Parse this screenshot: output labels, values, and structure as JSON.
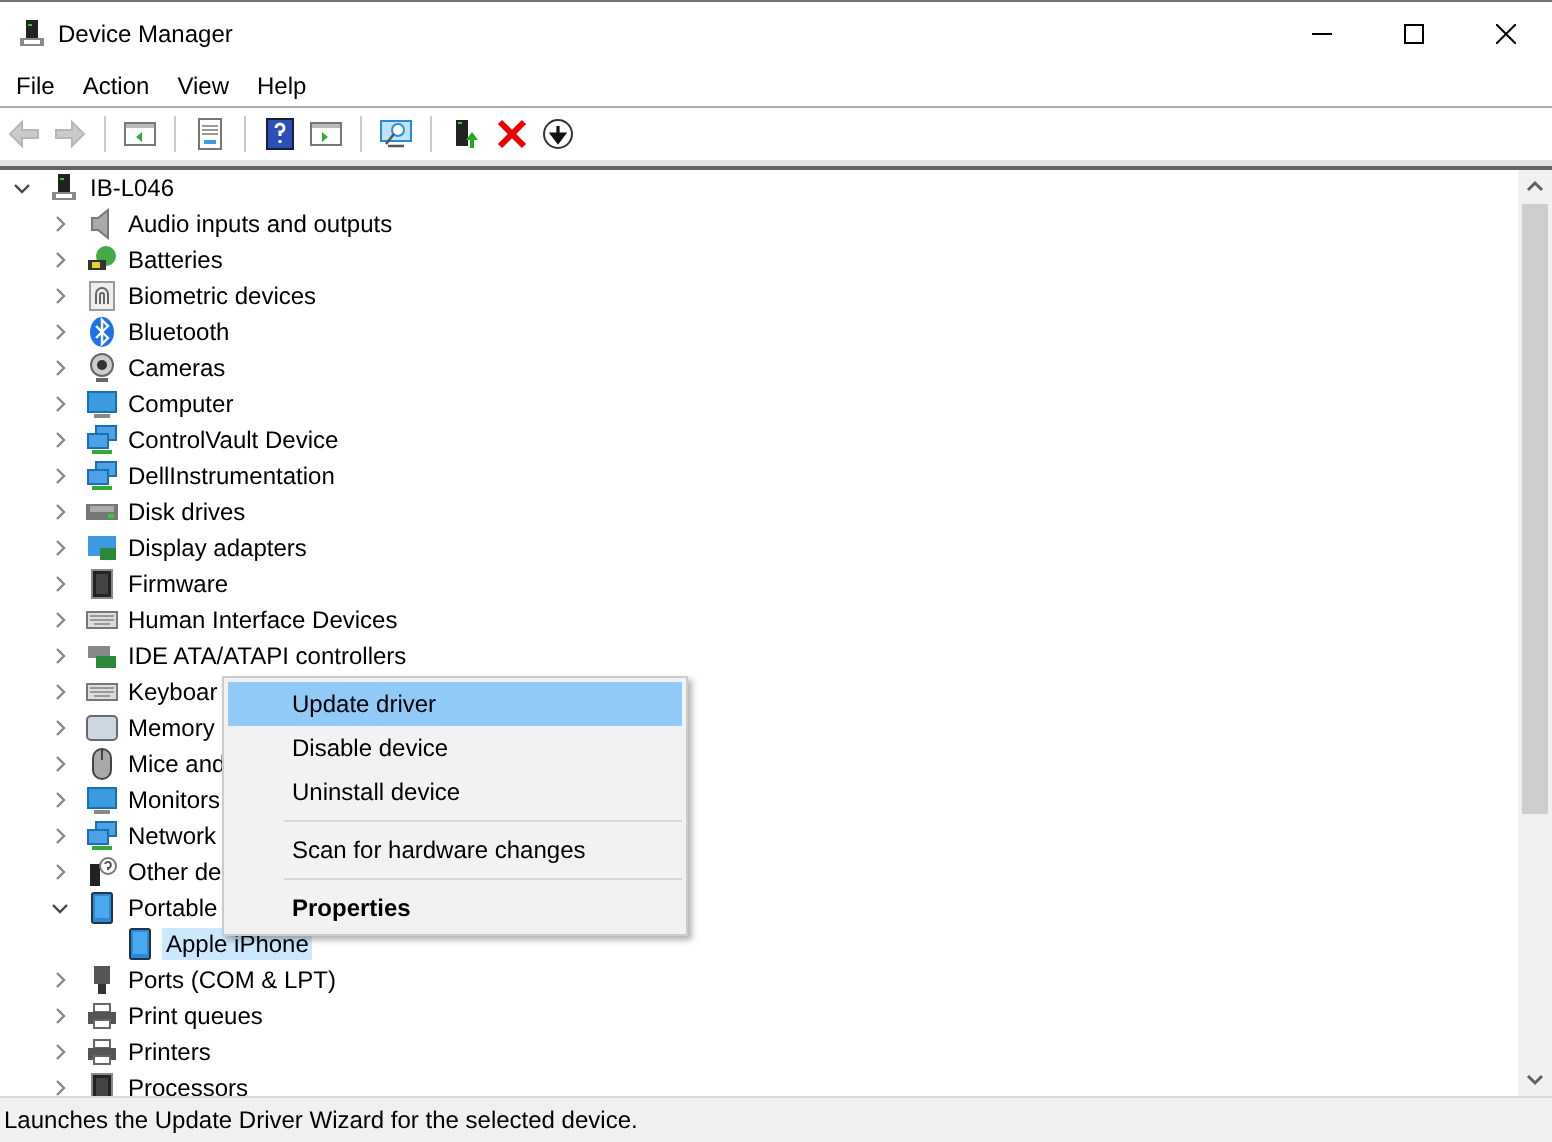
{
  "window": {
    "title": "Device Manager"
  },
  "menu_bar": [
    "File",
    "Action",
    "View",
    "Help"
  ],
  "toolbar": [
    {
      "disabled": true,
      "separator_before": false
    },
    {
      "disabled": true,
      "separator_before": false
    },
    {
      "disabled": false,
      "separator_before": true
    },
    {
      "disabled": false,
      "separator_before": true
    },
    {
      "disabled": false,
      "separator_before": true
    },
    {
      "disabled": false,
      "separator_before": false
    },
    {
      "disabled": false,
      "separator_before": true
    },
    {
      "disabled": false,
      "separator_before": true
    },
    {
      "disabled": false,
      "separator_before": false
    },
    {
      "disabled": false,
      "separator_before": false
    }
  ],
  "tree": {
    "label": "IB-L046",
    "expanded": true,
    "selected": false,
    "children": [
      {
        "label": "Audio inputs and outputs",
        "expanded": false,
        "selected": false
      },
      {
        "label": "Batteries",
        "expanded": false,
        "selected": false
      },
      {
        "label": "Biometric devices",
        "expanded": false,
        "selected": false
      },
      {
        "label": "Bluetooth",
        "expanded": false,
        "selected": false
      },
      {
        "label": "Cameras",
        "expanded": false,
        "selected": false
      },
      {
        "label": "Computer",
        "expanded": false,
        "selected": false
      },
      {
        "label": "ControlVault Device",
        "expanded": false,
        "selected": false
      },
      {
        "label": "DellInstrumentation",
        "expanded": false,
        "selected": false
      },
      {
        "label": "Disk drives",
        "expanded": false,
        "selected": false
      },
      {
        "label": "Display adapters",
        "expanded": false,
        "selected": false
      },
      {
        "label": "Firmware",
        "expanded": false,
        "selected": false
      },
      {
        "label": "Human Interface Devices",
        "expanded": false,
        "selected": false
      },
      {
        "label": "IDE ATA/ATAPI controllers",
        "expanded": false,
        "selected": false
      },
      {
        "label": "Keyboar",
        "expanded": false,
        "selected": false
      },
      {
        "label": "Memory",
        "expanded": false,
        "selected": false
      },
      {
        "label": "Mice and",
        "expanded": false,
        "selected": false
      },
      {
        "label": "Monitors",
        "expanded": false,
        "selected": false
      },
      {
        "label": "Network",
        "expanded": false,
        "selected": false
      },
      {
        "label": "Other de",
        "expanded": false,
        "selected": false
      },
      {
        "label": "Portable",
        "expanded": true,
        "selected": false,
        "children": [
          {
            "label": "Apple iPhone",
            "selected": true
          }
        ]
      },
      {
        "label": "Ports (COM & LPT)",
        "expanded": false,
        "selected": false
      },
      {
        "label": "Print queues",
        "expanded": false,
        "selected": false
      },
      {
        "label": "Printers",
        "expanded": false,
        "selected": false
      },
      {
        "label": "Processors",
        "expanded": false,
        "selected": false
      }
    ]
  },
  "context_menu": [
    {
      "label": "Update driver",
      "selected": true,
      "default": false,
      "separator_before": false
    },
    {
      "label": "Disable device",
      "selected": false,
      "default": false,
      "separator_before": false
    },
    {
      "label": "Uninstall device",
      "selected": false,
      "default": false,
      "separator_before": false
    },
    {
      "label": "Scan for hardware changes",
      "selected": false,
      "default": false,
      "separator_before": true
    },
    {
      "label": "Properties",
      "selected": false,
      "default": true,
      "separator_before": true
    }
  ],
  "status_bar": "Launches the Update Driver Wizard for the selected device."
}
